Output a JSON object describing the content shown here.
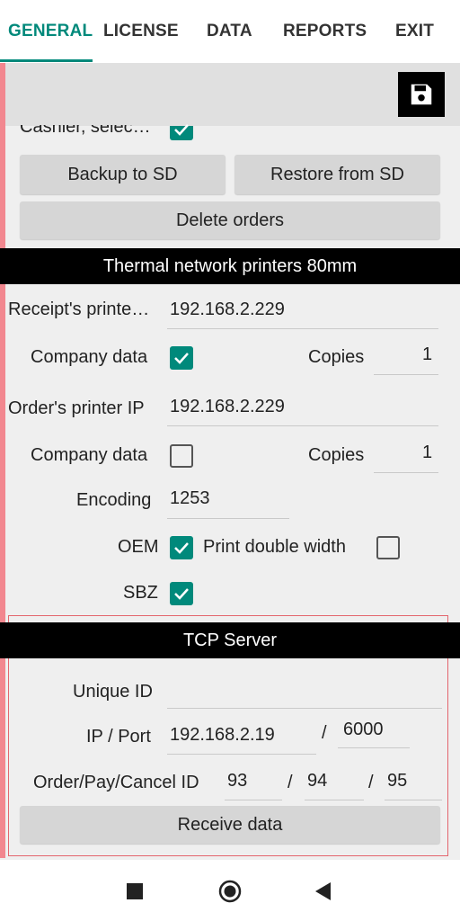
{
  "tabs": [
    {
      "label": "GENERAL",
      "active": true
    },
    {
      "label": "LICENSE",
      "active": false
    },
    {
      "label": "DATA",
      "active": false
    },
    {
      "label": "REPORTS",
      "active": false
    },
    {
      "label": "EXIT",
      "active": false
    }
  ],
  "toolbar": {
    "save_icon": "floppy-disk-icon"
  },
  "general": {
    "cashier_label": "Cashier, selec…",
    "cashier_checked": true,
    "backup_label": "Backup to SD",
    "restore_label": "Restore from SD",
    "delete_label": "Delete orders"
  },
  "printers": {
    "title": "Thermal network printers 80mm",
    "receipt_printer_label": "Receipt's printe…",
    "receipt_printer_ip": "192.168.2.229",
    "receipt_company_label": "Company data",
    "receipt_company_checked": true,
    "receipt_copies_label": "Copies",
    "receipt_copies": "1",
    "order_printer_label": "Order's printer IP",
    "order_printer_ip": "192.168.2.229",
    "order_company_label": "Company data",
    "order_company_checked": false,
    "order_copies_label": "Copies",
    "order_copies": "1",
    "encoding_label": "Encoding",
    "encoding": "1253",
    "oem_label": "OEM",
    "oem_checked": true,
    "double_width_label": "Print double width",
    "double_width_checked": false,
    "sbz_label": "SBZ",
    "sbz_checked": true
  },
  "tcp": {
    "title": "TCP Server",
    "unique_id_label": "Unique ID",
    "unique_id": "",
    "ip_port_label": "IP / Port",
    "ip": "192.168.2.19",
    "port_separator": "/",
    "port": "6000",
    "ids_label": "Order/Pay/Cancel ID",
    "order_id": "93",
    "pay_id": "94",
    "cancel_id": "95",
    "id_separator": "/",
    "receive_label": "Receive data"
  },
  "navbar": {
    "recents_icon": "square-icon",
    "home_icon": "circle-icon",
    "back_icon": "triangle-back-icon"
  },
  "colors": {
    "accent": "#00897b",
    "left_stripe": "#f2878f",
    "frame": "#e3656d"
  }
}
